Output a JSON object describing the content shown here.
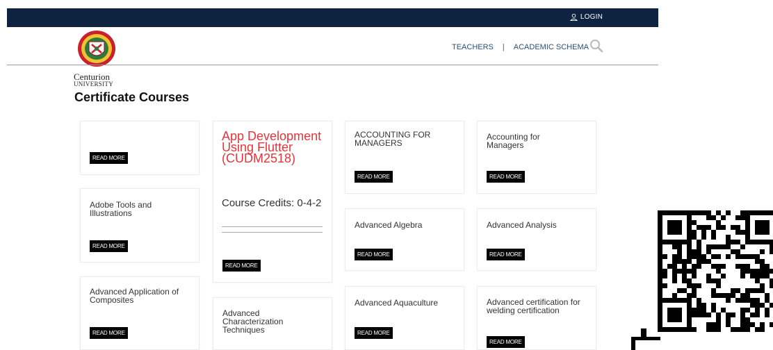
{
  "header": {
    "login_label": "LOGIN",
    "bar_color": "#0d2340",
    "nav": [
      {
        "label": "TEACHERS"
      },
      {
        "label": "ACADEMIC SCHEMA"
      }
    ],
    "separator": "|"
  },
  "logo": {
    "name": "Centurion",
    "sub": "UNIVERSITY"
  },
  "page": {
    "title": "Certificate Courses"
  },
  "read_more_label": "READ MORE",
  "courses": [
    {
      "title": "",
      "button": "READ MORE"
    },
    {
      "title": "Adobe Tools and Illustrations",
      "button": "READ MORE"
    },
    {
      "title": "Advanced Application of Composites",
      "button": "READ MORE"
    },
    {
      "title": "App Development Using Flutter (CUDM2518)",
      "credits": "Course Credits: 0-4-2",
      "button": "READ MORE",
      "accent": "#e5353a"
    },
    {
      "title": "Advanced Characterization Techniques"
    },
    {
      "title": "ACCOUNTING FOR MANAGERS",
      "button": "READ MORE"
    },
    {
      "title": "Advanced Algebra",
      "button": "READ MORE"
    },
    {
      "title": "Advanced Aquaculture",
      "button": "READ MORE"
    },
    {
      "title": "Accounting for Managers",
      "button": "READ MORE"
    },
    {
      "title": "Advanced Analysis",
      "button": "READ MORE"
    },
    {
      "title": "Advanced certification for welding certification",
      "button": "READ MORE"
    }
  ],
  "icons": {
    "user": "user-icon",
    "search": "search-icon",
    "qr": "qr-code-icon"
  }
}
